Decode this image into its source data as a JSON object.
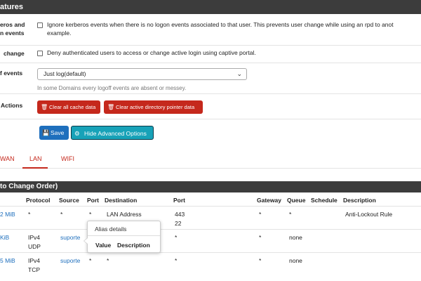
{
  "section_header": "atures",
  "rows": {
    "kerberos": {
      "label_line1": "eros and",
      "label_line2": "n events",
      "text_line1": "Ignore kerberos events when there is no logon events associated to that user. This prevents user change while using an rpd to anot",
      "text_line2": "example."
    },
    "deny": {
      "label": "change",
      "text": "Deny authenticated users to access or change active login using captive portal."
    },
    "logoff": {
      "label": "f events",
      "select_value": "Just log(default)",
      "help": "In some Domains every logoff events are absent or messey."
    },
    "actions": {
      "label": "Actions",
      "clear_cache": "Clear all cache data",
      "clear_ad": "Clear active directory pointer data"
    }
  },
  "buttons": {
    "save": "Save",
    "hide_advanced": "Hide Advanced Options"
  },
  "tabs": [
    "WAN",
    "LAN",
    "WIFI"
  ],
  "active_tab": "LAN",
  "table": {
    "header": "to Change Order)",
    "columns": [
      "Protocol",
      "Source",
      "Port",
      "Destination",
      "Port",
      "Gateway",
      "Queue",
      "Schedule",
      "Description"
    ],
    "rows": [
      {
        "states": "2 MiB",
        "protocol_1": "*",
        "protocol_2": "",
        "source": "*",
        "port": "*",
        "destination": "LAN Address",
        "dest_port_1": "443",
        "dest_port_2": "22",
        "gateway": "*",
        "queue": "*",
        "description": "Anti-Lockout Rule"
      },
      {
        "states": "KiB",
        "protocol_1": "IPv4",
        "protocol_2": "UDP",
        "source": "suporte",
        "port": "",
        "destination": "",
        "dest_port_1": "*",
        "dest_port_2": "",
        "gateway": "*",
        "queue": "none",
        "description": ""
      },
      {
        "states": "5 MiB",
        "protocol_1": "IPv4",
        "protocol_2": "TCP",
        "source": "suporte",
        "port": "*",
        "destination": "*",
        "dest_port_1": "*",
        "dest_port_2": "",
        "gateway": "*",
        "queue": "none",
        "description": ""
      }
    ]
  },
  "tooltip": {
    "title": "Alias details",
    "col_value": "Value",
    "col_description": "Description"
  },
  "icons": {
    "trash": "trash-icon",
    "save": "save-icon",
    "gear": "gear-icon",
    "chevron": "chevron-down-icon"
  },
  "colors": {
    "header_bg": "#3c3c3c",
    "danger": "#c5281c",
    "primary": "#1e6fbd",
    "info": "#17a2b8",
    "link": "#1e6fbd"
  }
}
